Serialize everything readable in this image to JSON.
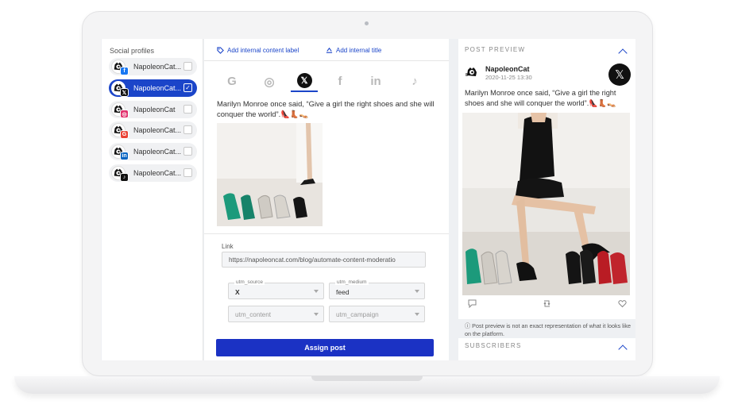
{
  "colors": {
    "accent": "#1b45c9",
    "button": "#1b32c4",
    "panel_bg": "#eef0f3",
    "selected_profile": "#1b45c9"
  },
  "sidebar": {
    "title": "Social profiles",
    "profiles": [
      {
        "name": "NapoleonCat...",
        "network": "facebook",
        "badge": "f",
        "badge_color": "#1877f2",
        "selected": false
      },
      {
        "name": "NapoleonCat...",
        "network": "x",
        "badge": "𝕏",
        "badge_color": "#111111",
        "selected": true,
        "check": "✓"
      },
      {
        "name": "NapoleonCat",
        "network": "instagram",
        "badge": "◎",
        "badge_color": "#e1306c",
        "selected": false
      },
      {
        "name": "NapoleonCat...",
        "network": "google",
        "badge": "G",
        "badge_color": "#ea4335",
        "selected": false
      },
      {
        "name": "NapoleonCat...",
        "network": "linkedin",
        "badge": "in",
        "badge_color": "#0a66c2",
        "selected": false
      },
      {
        "name": "NapoleonCat...",
        "network": "tiktok",
        "badge": "♪",
        "badge_color": "#111111",
        "selected": false
      }
    ]
  },
  "editor": {
    "add_label_link": "Add internal content label",
    "add_title_link": "Add internal title",
    "tabs": [
      {
        "name": "google",
        "glyph": "G",
        "active": false
      },
      {
        "name": "instagram",
        "glyph": "◎",
        "active": false
      },
      {
        "name": "x",
        "glyph": "𝕏",
        "active": true
      },
      {
        "name": "facebook",
        "glyph": "f",
        "active": false
      },
      {
        "name": "linkedin",
        "glyph": "in",
        "active": false
      },
      {
        "name": "tiktok",
        "glyph": "♪",
        "active": false
      }
    ],
    "post_text": "Marilyn Monroe once said, “Give a girl the right shoes and she will conquer the world”.👠👢👡",
    "link_label": "Link",
    "link_value": "https://napoleoncat.com/blog/automate-content-moderatio",
    "utm": {
      "source_label": "utm_source",
      "source_value": "X",
      "medium_label": "utm_medium",
      "medium_value": "feed",
      "content_placeholder": "utm_content",
      "campaign_placeholder": "utm_campaign"
    },
    "assign_button": "Assign post"
  },
  "preview": {
    "title": "POST PREVIEW",
    "account_name": "NapoleonCat",
    "timestamp": "2020-11-25 13:30",
    "text": "Marilyn Monroe once said, “Give a girl the right shoes and she will conquer the world”.👠👢👡",
    "disclaimer": "ⓘ Post preview is not an exact representation of what it looks like on the platform.",
    "icons": [
      "reply-icon",
      "repost-icon",
      "like-icon"
    ]
  },
  "subscribers": {
    "title": "SUBSCRIBERS"
  }
}
